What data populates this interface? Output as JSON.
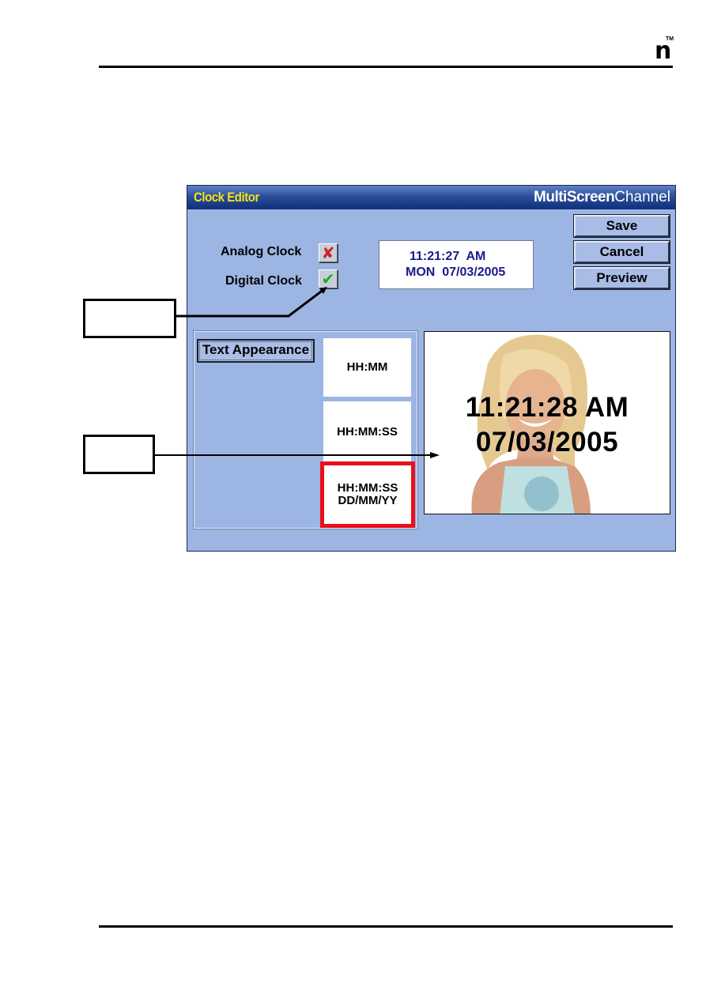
{
  "page": {
    "logo": {
      "letter": "n",
      "trademark": "TM"
    }
  },
  "window": {
    "title": "Clock Editor",
    "brand_bold": "MultiScreen",
    "brand_light": "Channel",
    "options": [
      {
        "label": "Analog Clock",
        "state": "unchecked",
        "icon": "x-mark-icon",
        "glyph": "✘"
      },
      {
        "label": "Digital Clock",
        "state": "checked",
        "icon": "check-mark-icon",
        "glyph": "✔"
      }
    ],
    "digital_display": {
      "time": "11:21:27  AM",
      "date": "MON  07/03/2005"
    },
    "buttons": {
      "save": "Save",
      "cancel": "Cancel",
      "preview": "Preview"
    },
    "text_appearance_label": "Text Appearance",
    "formats": [
      {
        "label": "HH:MM",
        "selected": false
      },
      {
        "label": "HH:MM:SS",
        "selected": false
      },
      {
        "label_line1": "HH:MM:SS",
        "label_line2": "DD/MM/YY",
        "selected": true
      }
    ],
    "preview": {
      "time": "11:21:28 AM",
      "date": "07/03/2005"
    }
  },
  "colors": {
    "window_bg": "#9db5e3",
    "title_text": "#f5e21a",
    "title_bar": "#1a3d8a",
    "digital_text": "#1a1a8c",
    "selected_border": "#e8101a"
  }
}
